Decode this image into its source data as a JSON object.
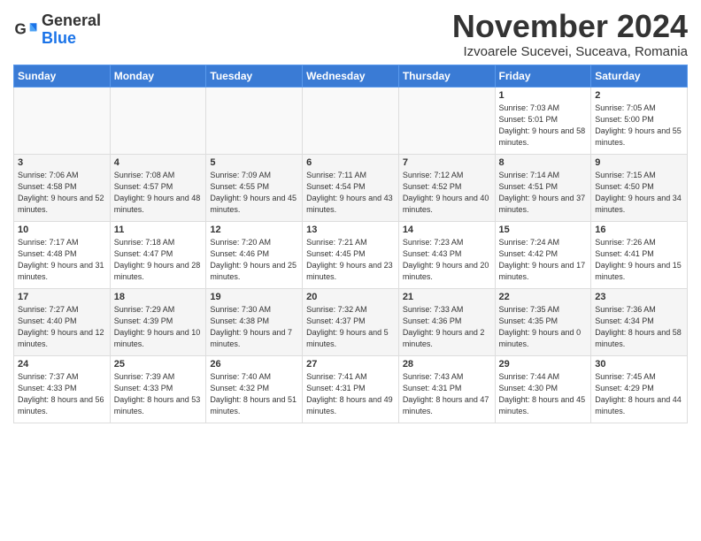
{
  "logo": {
    "general": "General",
    "blue": "Blue"
  },
  "title": "November 2024",
  "location": "Izvoarele Sucevei, Suceava, Romania",
  "headers": [
    "Sunday",
    "Monday",
    "Tuesday",
    "Wednesday",
    "Thursday",
    "Friday",
    "Saturday"
  ],
  "weeks": [
    [
      {
        "day": "",
        "info": ""
      },
      {
        "day": "",
        "info": ""
      },
      {
        "day": "",
        "info": ""
      },
      {
        "day": "",
        "info": ""
      },
      {
        "day": "",
        "info": ""
      },
      {
        "day": "1",
        "info": "Sunrise: 7:03 AM\nSunset: 5:01 PM\nDaylight: 9 hours and 58 minutes."
      },
      {
        "day": "2",
        "info": "Sunrise: 7:05 AM\nSunset: 5:00 PM\nDaylight: 9 hours and 55 minutes."
      }
    ],
    [
      {
        "day": "3",
        "info": "Sunrise: 7:06 AM\nSunset: 4:58 PM\nDaylight: 9 hours and 52 minutes."
      },
      {
        "day": "4",
        "info": "Sunrise: 7:08 AM\nSunset: 4:57 PM\nDaylight: 9 hours and 48 minutes."
      },
      {
        "day": "5",
        "info": "Sunrise: 7:09 AM\nSunset: 4:55 PM\nDaylight: 9 hours and 45 minutes."
      },
      {
        "day": "6",
        "info": "Sunrise: 7:11 AM\nSunset: 4:54 PM\nDaylight: 9 hours and 43 minutes."
      },
      {
        "day": "7",
        "info": "Sunrise: 7:12 AM\nSunset: 4:52 PM\nDaylight: 9 hours and 40 minutes."
      },
      {
        "day": "8",
        "info": "Sunrise: 7:14 AM\nSunset: 4:51 PM\nDaylight: 9 hours and 37 minutes."
      },
      {
        "day": "9",
        "info": "Sunrise: 7:15 AM\nSunset: 4:50 PM\nDaylight: 9 hours and 34 minutes."
      }
    ],
    [
      {
        "day": "10",
        "info": "Sunrise: 7:17 AM\nSunset: 4:48 PM\nDaylight: 9 hours and 31 minutes."
      },
      {
        "day": "11",
        "info": "Sunrise: 7:18 AM\nSunset: 4:47 PM\nDaylight: 9 hours and 28 minutes."
      },
      {
        "day": "12",
        "info": "Sunrise: 7:20 AM\nSunset: 4:46 PM\nDaylight: 9 hours and 25 minutes."
      },
      {
        "day": "13",
        "info": "Sunrise: 7:21 AM\nSunset: 4:45 PM\nDaylight: 9 hours and 23 minutes."
      },
      {
        "day": "14",
        "info": "Sunrise: 7:23 AM\nSunset: 4:43 PM\nDaylight: 9 hours and 20 minutes."
      },
      {
        "day": "15",
        "info": "Sunrise: 7:24 AM\nSunset: 4:42 PM\nDaylight: 9 hours and 17 minutes."
      },
      {
        "day": "16",
        "info": "Sunrise: 7:26 AM\nSunset: 4:41 PM\nDaylight: 9 hours and 15 minutes."
      }
    ],
    [
      {
        "day": "17",
        "info": "Sunrise: 7:27 AM\nSunset: 4:40 PM\nDaylight: 9 hours and 12 minutes."
      },
      {
        "day": "18",
        "info": "Sunrise: 7:29 AM\nSunset: 4:39 PM\nDaylight: 9 hours and 10 minutes."
      },
      {
        "day": "19",
        "info": "Sunrise: 7:30 AM\nSunset: 4:38 PM\nDaylight: 9 hours and 7 minutes."
      },
      {
        "day": "20",
        "info": "Sunrise: 7:32 AM\nSunset: 4:37 PM\nDaylight: 9 hours and 5 minutes."
      },
      {
        "day": "21",
        "info": "Sunrise: 7:33 AM\nSunset: 4:36 PM\nDaylight: 9 hours and 2 minutes."
      },
      {
        "day": "22",
        "info": "Sunrise: 7:35 AM\nSunset: 4:35 PM\nDaylight: 9 hours and 0 minutes."
      },
      {
        "day": "23",
        "info": "Sunrise: 7:36 AM\nSunset: 4:34 PM\nDaylight: 8 hours and 58 minutes."
      }
    ],
    [
      {
        "day": "24",
        "info": "Sunrise: 7:37 AM\nSunset: 4:33 PM\nDaylight: 8 hours and 56 minutes."
      },
      {
        "day": "25",
        "info": "Sunrise: 7:39 AM\nSunset: 4:33 PM\nDaylight: 8 hours and 53 minutes."
      },
      {
        "day": "26",
        "info": "Sunrise: 7:40 AM\nSunset: 4:32 PM\nDaylight: 8 hours and 51 minutes."
      },
      {
        "day": "27",
        "info": "Sunrise: 7:41 AM\nSunset: 4:31 PM\nDaylight: 8 hours and 49 minutes."
      },
      {
        "day": "28",
        "info": "Sunrise: 7:43 AM\nSunset: 4:31 PM\nDaylight: 8 hours and 47 minutes."
      },
      {
        "day": "29",
        "info": "Sunrise: 7:44 AM\nSunset: 4:30 PM\nDaylight: 8 hours and 45 minutes."
      },
      {
        "day": "30",
        "info": "Sunrise: 7:45 AM\nSunset: 4:29 PM\nDaylight: 8 hours and 44 minutes."
      }
    ]
  ]
}
